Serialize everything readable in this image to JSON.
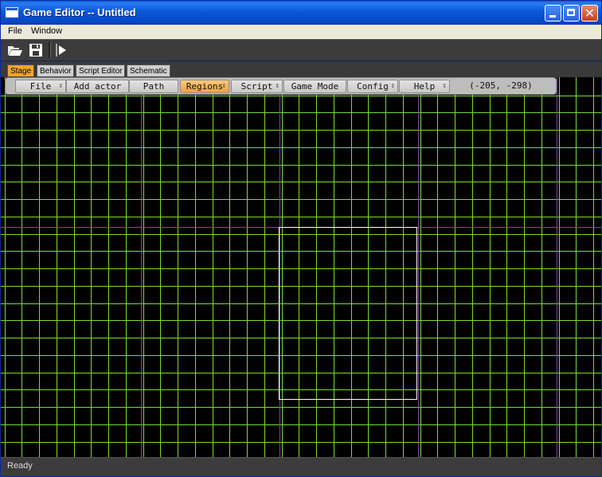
{
  "window": {
    "title": "Game Editor -- Untitled"
  },
  "menubar": {
    "items": [
      {
        "label": "File"
      },
      {
        "label": "Window"
      }
    ]
  },
  "toolbar": {
    "tools": [
      {
        "icon": "open-folder-icon"
      },
      {
        "icon": "save-disk-icon"
      },
      {
        "icon": "play-icon"
      }
    ]
  },
  "tabs": [
    {
      "label": "Stage",
      "active": true
    },
    {
      "label": "Behavior",
      "active": false
    },
    {
      "label": "Script Editor",
      "active": false
    },
    {
      "label": "Schematic",
      "active": false
    }
  ],
  "stage_menu": {
    "buttons": [
      {
        "label": "File",
        "dropdown": true,
        "active": false
      },
      {
        "label": "Add actor",
        "dropdown": false,
        "active": false
      },
      {
        "label": "Path",
        "dropdown": false,
        "active": false
      },
      {
        "label": "Regions",
        "dropdown": true,
        "active": true
      },
      {
        "label": "Script",
        "dropdown": true,
        "active": false
      },
      {
        "label": "Game Mode",
        "dropdown": false,
        "active": false
      },
      {
        "label": "Config",
        "dropdown": true,
        "active": false
      },
      {
        "label": "Help",
        "dropdown": true,
        "active": false
      }
    ],
    "coordinates": "(-205, -298)"
  },
  "canvas": {
    "grid_color": "#7ddc2a",
    "axis_color": "#8a3fb5",
    "view_rect_color": "#ffffff",
    "background": "#000000"
  },
  "status": {
    "text": "Ready"
  }
}
